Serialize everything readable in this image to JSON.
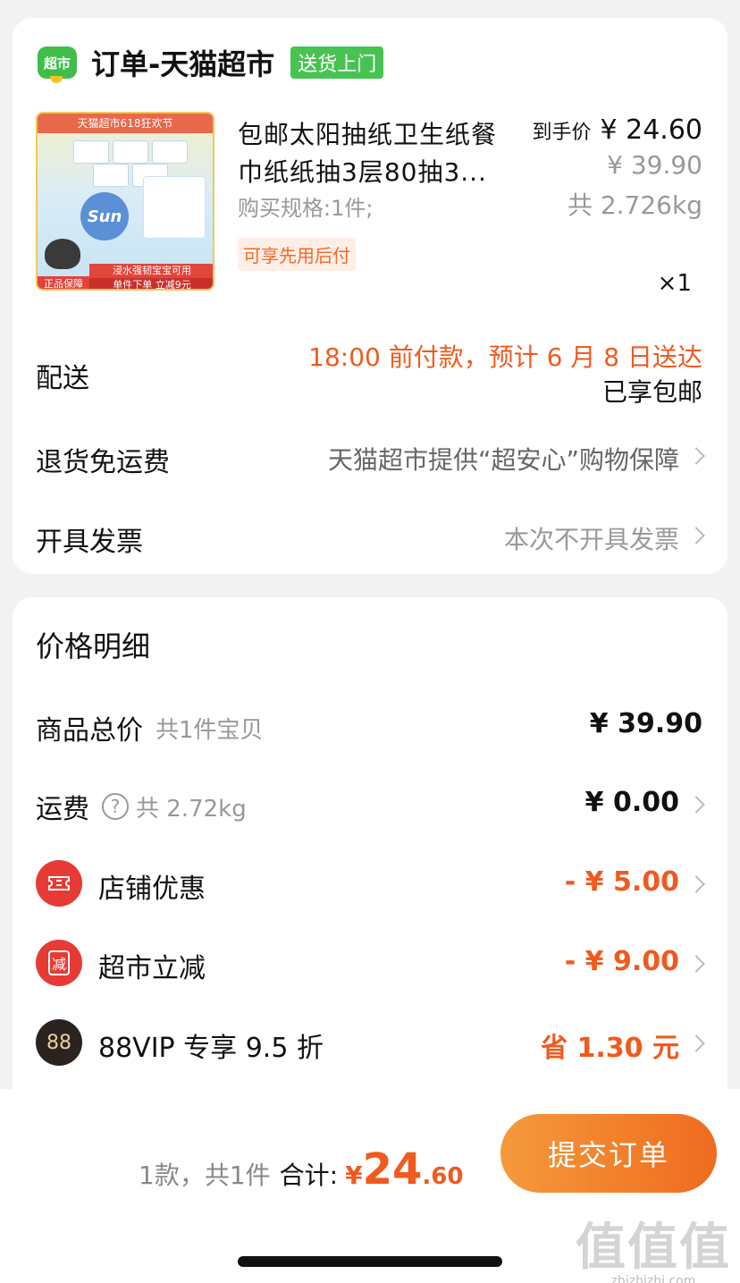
{
  "order": {
    "shop_logo_text": "超市",
    "shop_name": "订单-天猫超市",
    "delivery_badge": "送货上门",
    "product": {
      "image_banner": "天猫超市618狂欢节",
      "image_brand": "Sun",
      "image_bar_1": "浸水强韧宝宝可用",
      "image_bar_2": "单件下单 立减9元",
      "image_tag": "正品保障",
      "title_line_1": "包邮太阳抽纸卫生纸餐",
      "title_line_2": "巾纸纸抽3层80抽3...",
      "price_label": "到手价",
      "final_price": "¥ 24.60",
      "original_price": "¥ 39.90",
      "spec": "购买规格:1件;",
      "weight": "共 2.726kg",
      "paylater_badge": "可享先用后付",
      "quantity": "×1"
    },
    "rows": {
      "shipping_label": "配送",
      "shipping_eta": "18:00 前付款，预计 6 月 8 日送达",
      "shipping_free": "已享包邮",
      "return_label": "退货免运费",
      "return_value": "天猫超市提供“超安心”购物保障",
      "invoice_label": "开具发票",
      "invoice_value": "本次不开具发票"
    }
  },
  "price_detail": {
    "title": "价格明细",
    "items_total_label": "商品总价",
    "items_total_sub": "共1件宝贝",
    "items_total_value": "¥ 39.90",
    "freight_label": "运费",
    "freight_help": "?",
    "freight_sub": "共 2.72kg",
    "freight_value": "¥ 0.00",
    "store_discount_label": "店铺优惠",
    "store_discount_value": "- ¥ 5.00",
    "market_discount_icon": "减",
    "market_discount_label": "超市立减",
    "market_discount_value": "- ¥ 9.00",
    "vip_icon": "88",
    "vip_label": "88VIP 专享 9.5 折",
    "vip_value": "省 1.30 元"
  },
  "bottom": {
    "count_text": "1款，共1件",
    "total_label": "合计:",
    "currency": "¥",
    "total_int": "24",
    "total_dec": ".60",
    "submit_label": "提交订单",
    "watermark": "值值值",
    "watermark_url": "zhizhizhi.com"
  },
  "colors": {
    "accent_orange": "#f05a1e",
    "discount_red": "#e63b34",
    "badge_green": "#47c352"
  }
}
